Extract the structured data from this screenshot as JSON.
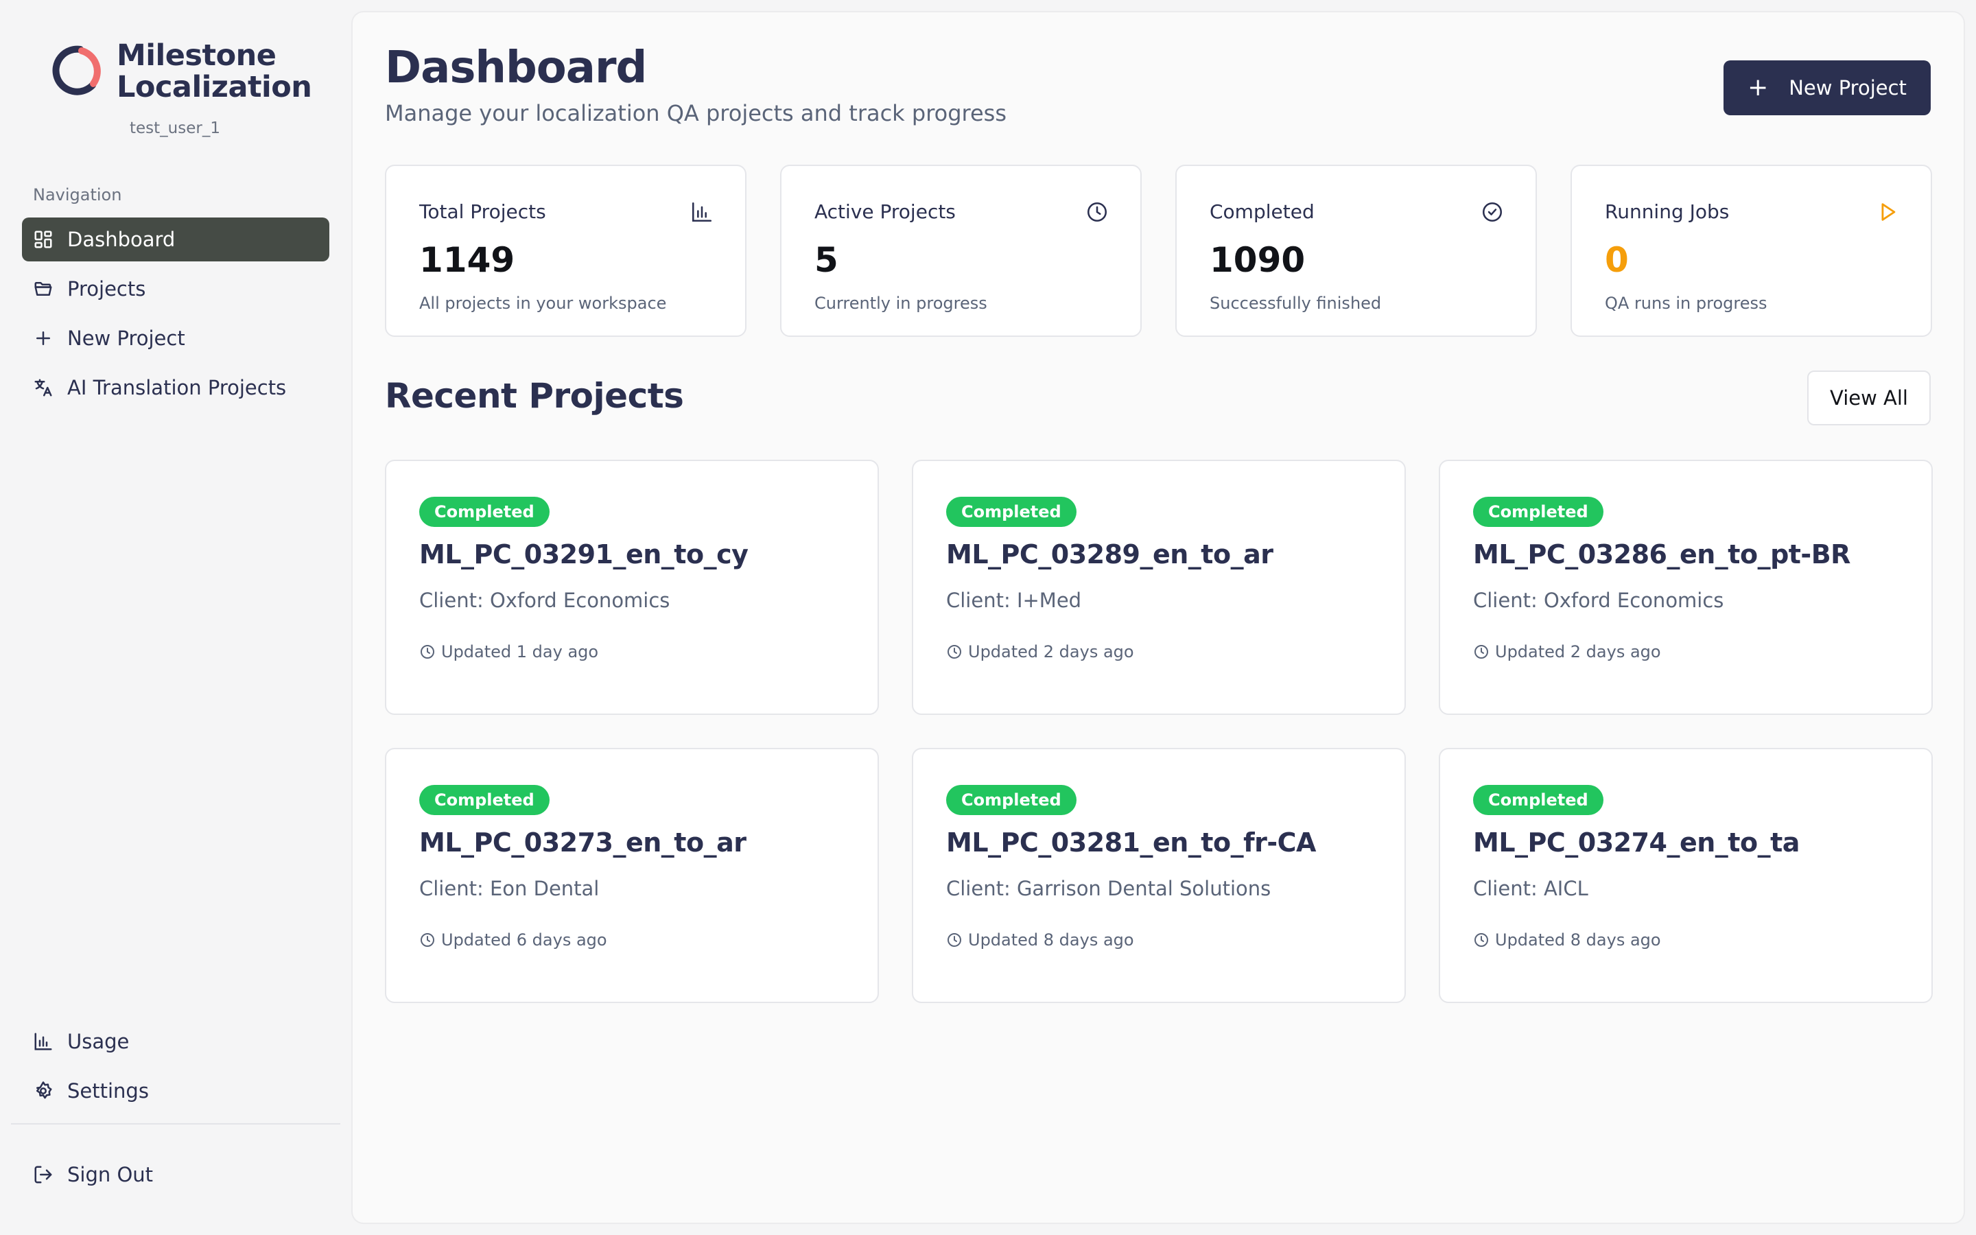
{
  "brand": {
    "name_line1": "Milestone",
    "name_line2": "Localization",
    "user": "test_user_1",
    "colors": {
      "primary": "#2b3050",
      "accent": "#f06e6e"
    }
  },
  "nav": {
    "label": "Navigation",
    "items": [
      {
        "label": "Dashboard",
        "icon": "dashboard-grid-icon",
        "active": true
      },
      {
        "label": "Projects",
        "icon": "folder-icon"
      },
      {
        "label": "New Project",
        "icon": "plus-icon"
      },
      {
        "label": "AI Translation Projects",
        "icon": "translate-icon"
      }
    ],
    "bottom": [
      {
        "label": "Usage",
        "icon": "bar-chart-icon"
      },
      {
        "label": "Settings",
        "icon": "gear-icon"
      }
    ],
    "signout": {
      "label": "Sign Out",
      "icon": "logout-icon"
    }
  },
  "header": {
    "title": "Dashboard",
    "subtitle": "Manage your localization QA projects and track progress",
    "new_project_label": "New Project"
  },
  "stats": [
    {
      "label": "Total Projects",
      "value": "1149",
      "desc": "All projects in your workspace",
      "icon": "bar-chart-icon"
    },
    {
      "label": "Active Projects",
      "value": "5",
      "desc": "Currently in progress",
      "icon": "clock-icon"
    },
    {
      "label": "Completed",
      "value": "1090",
      "desc": "Successfully finished",
      "icon": "check-circle-icon"
    },
    {
      "label": "Running Jobs",
      "value": "0",
      "desc": "QA runs in progress",
      "icon": "play-icon",
      "color": "#f59e0b"
    }
  ],
  "recent": {
    "title": "Recent Projects",
    "view_all_label": "View All",
    "projects": [
      {
        "status": "Completed",
        "name": "ML_PC_03291_en_to_cy",
        "client": "Client: Oxford Economics",
        "updated": "Updated 1 day ago"
      },
      {
        "status": "Completed",
        "name": "ML_PC_03289_en_to_ar",
        "client": "Client: I+Med",
        "updated": "Updated 2 days ago"
      },
      {
        "status": "Completed",
        "name": "ML_PC_03286_en_to_pt-BR",
        "client": "Client: Oxford Economics",
        "updated": "Updated 2 days ago"
      },
      {
        "status": "Completed",
        "name": "ML_PC_03273_en_to_ar",
        "client": "Client: Eon Dental",
        "updated": "Updated 6 days ago"
      },
      {
        "status": "Completed",
        "name": "ML_PC_03281_en_to_fr-CA",
        "client": "Client: Garrison Dental Solutions",
        "updated": "Updated 8 days ago"
      },
      {
        "status": "Completed",
        "name": "ML_PC_03274_en_to_ta",
        "client": "Client: AICL",
        "updated": "Updated 8 days ago"
      }
    ],
    "status_color": "#22c55e"
  }
}
